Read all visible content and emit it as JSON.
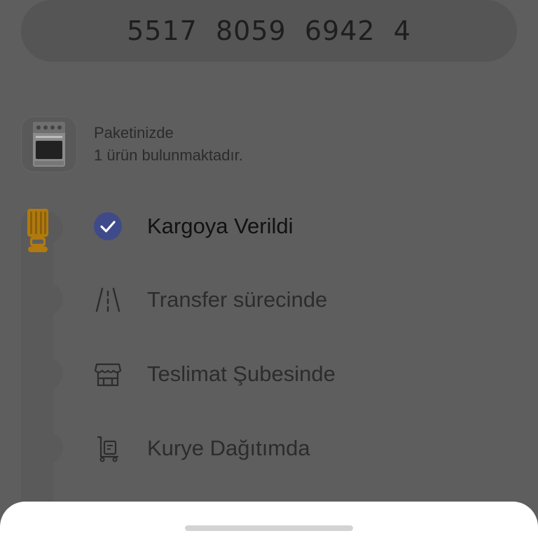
{
  "tracking": {
    "number": "5517  8059  6942  4"
  },
  "package": {
    "line1": "Paketinizde",
    "line2": "1 ürün bulunmaktadır.",
    "thumbnail_icon": "stove-oven-icon"
  },
  "timeline": {
    "current_icon": "delivery-truck-icon",
    "accent_color": "#3f4a8a",
    "truck_color": "#b07a10",
    "steps": [
      {
        "label": "Kargoya Verildi",
        "icon": "check-circle-icon",
        "done": true
      },
      {
        "label": "Transfer sürecinde",
        "icon": "road-icon",
        "done": false
      },
      {
        "label": "Teslimat Şubesinde",
        "icon": "store-icon",
        "done": false
      },
      {
        "label": "Kurye Dağıtımda",
        "icon": "courier-cart-icon",
        "done": false
      }
    ]
  }
}
